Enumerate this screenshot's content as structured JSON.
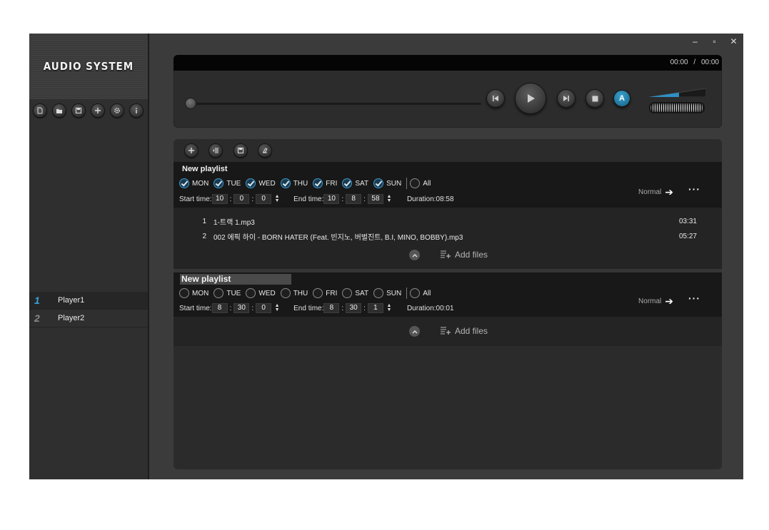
{
  "app": {
    "logo": "AUDIO SYSTEM",
    "sidebar_tools": [
      "new-file-icon",
      "open-folder-icon",
      "save-icon",
      "add-icon",
      "settings-gear-icon",
      "info-icon"
    ],
    "window_controls": {
      "minimize": "‒",
      "maximize": "▫",
      "close": "✕"
    }
  },
  "players": [
    {
      "num": "1",
      "name": "Player1",
      "active": true
    },
    {
      "num": "2",
      "name": "Player2",
      "active": false
    }
  ],
  "transport": {
    "current_time": "00:00",
    "total_time": "00:00",
    "time_sep": "/",
    "auto_label": "A",
    "accent": "#2f8fc4"
  },
  "playlist_tools": [
    "add-icon",
    "remove-list-icon",
    "save-icon",
    "clear-icon"
  ],
  "playlists": [
    {
      "title": "New playlist",
      "days": [
        {
          "label": "MON",
          "checked": true
        },
        {
          "label": "TUE",
          "checked": true
        },
        {
          "label": "WED",
          "checked": true
        },
        {
          "label": "THU",
          "checked": true
        },
        {
          "label": "FRI",
          "checked": true
        },
        {
          "label": "SAT",
          "checked": true
        },
        {
          "label": "SUN",
          "checked": true
        }
      ],
      "all_label": "All",
      "start_label": "Start time:",
      "start": [
        "10",
        "0",
        "0"
      ],
      "end_label": "End time:",
      "end": [
        "10",
        "8",
        "58"
      ],
      "duration": "Duration:08:58",
      "mode": "Normal",
      "tracks": [
        {
          "num": "1",
          "title": "1-트랙 1.mp3",
          "duration": "03:31"
        },
        {
          "num": "2",
          "title": "002 에픽 하이 - BORN HATER (Feat. 빈지노, 버벌진트, B.I, MINO, BOBBY).mp3",
          "duration": "05:27"
        }
      ],
      "add_files": "Add files"
    },
    {
      "title": "New playlist",
      "days": [
        {
          "label": "MON",
          "checked": false
        },
        {
          "label": "TUE",
          "checked": false
        },
        {
          "label": "WED",
          "checked": false
        },
        {
          "label": "THU",
          "checked": false
        },
        {
          "label": "FRI",
          "checked": false
        },
        {
          "label": "SAT",
          "checked": false
        },
        {
          "label": "SUN",
          "checked": false
        }
      ],
      "all_label": "All",
      "start_label": "Start time:",
      "start": [
        "8",
        "30",
        "0"
      ],
      "end_label": "End time:",
      "end": [
        "8",
        "30",
        "1"
      ],
      "duration": "Duration:00:01",
      "mode": "Normal",
      "tracks": [],
      "add_files": "Add files"
    }
  ]
}
